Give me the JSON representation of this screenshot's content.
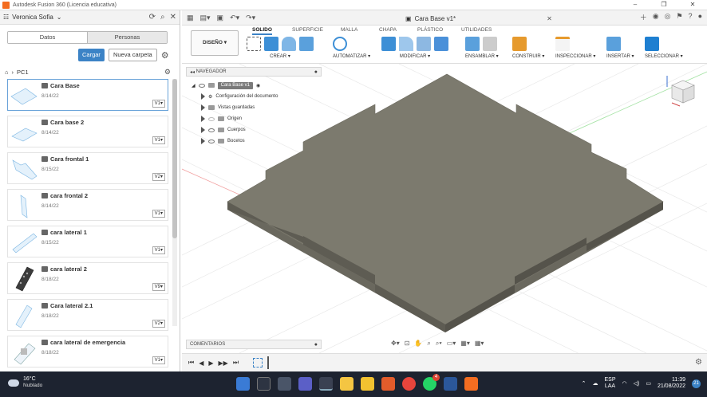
{
  "window": {
    "title": "Autodesk Fusion 360 (Licencia educativa)",
    "controls": [
      "–",
      "❐",
      "✕"
    ]
  },
  "data_panel": {
    "user_name": "Veronica Sofia",
    "tabs": [
      {
        "label": "Datos",
        "active": true
      },
      {
        "label": "Personas",
        "active": false
      }
    ],
    "upload_label": "Cargar",
    "new_folder_label": "Nueva carpeta",
    "breadcrumb": "PC1",
    "files": [
      {
        "name": "Cara Base",
        "date": "8/14/22",
        "version": "V1",
        "selected": true
      },
      {
        "name": "Cara base 2",
        "date": "8/14/22",
        "version": "V1",
        "selected": false
      },
      {
        "name": "Cara frontal 1",
        "date": "8/15/22",
        "version": "V2",
        "selected": false
      },
      {
        "name": "cara frontal 2",
        "date": "8/14/22",
        "version": "V1",
        "selected": false
      },
      {
        "name": "cara lateral 1",
        "date": "8/15/22",
        "version": "V1",
        "selected": false
      },
      {
        "name": "cara lateral 2",
        "date": "8/18/22",
        "version": "V9",
        "selected": false
      },
      {
        "name": "Cara lateral 2.1",
        "date": "8/18/22",
        "version": "V2",
        "selected": false
      },
      {
        "name": "cara lateral de emergencia",
        "date": "8/18/22",
        "version": "V1",
        "selected": false
      }
    ]
  },
  "document": {
    "tab_title": "Cara Base v1*"
  },
  "ribbon": {
    "workspace": "DISEÑO",
    "tabs": [
      "SOLIDO",
      "SUPERFICIE",
      "MALLA",
      "CHAPA",
      "PLÁSTICO",
      "UTILIDADES"
    ],
    "active_tab": "SOLIDO",
    "groups": [
      "CREAR",
      "AUTOMATIZAR",
      "MODIFICAR",
      "ENSAMBLAR",
      "CONSTRUIR",
      "INSPECCIONAR",
      "INSERTAR",
      "SELECCIONAR"
    ]
  },
  "navigator": {
    "title": "NAVEGADOR",
    "root": "Cara Base v1",
    "items": [
      "Configuración del documento",
      "Vistas guardadas",
      "Origen",
      "Cuerpos",
      "Bocetos"
    ]
  },
  "comments": {
    "title": "COMENTARIOS"
  },
  "taskbar": {
    "temperature": "16°C",
    "weather": "Nublado",
    "lang_top": "ESP",
    "lang_bottom": "LAA",
    "time": "11:39",
    "date": "21/08/2022",
    "notifications": "21",
    "whatsapp_badge": "4"
  }
}
